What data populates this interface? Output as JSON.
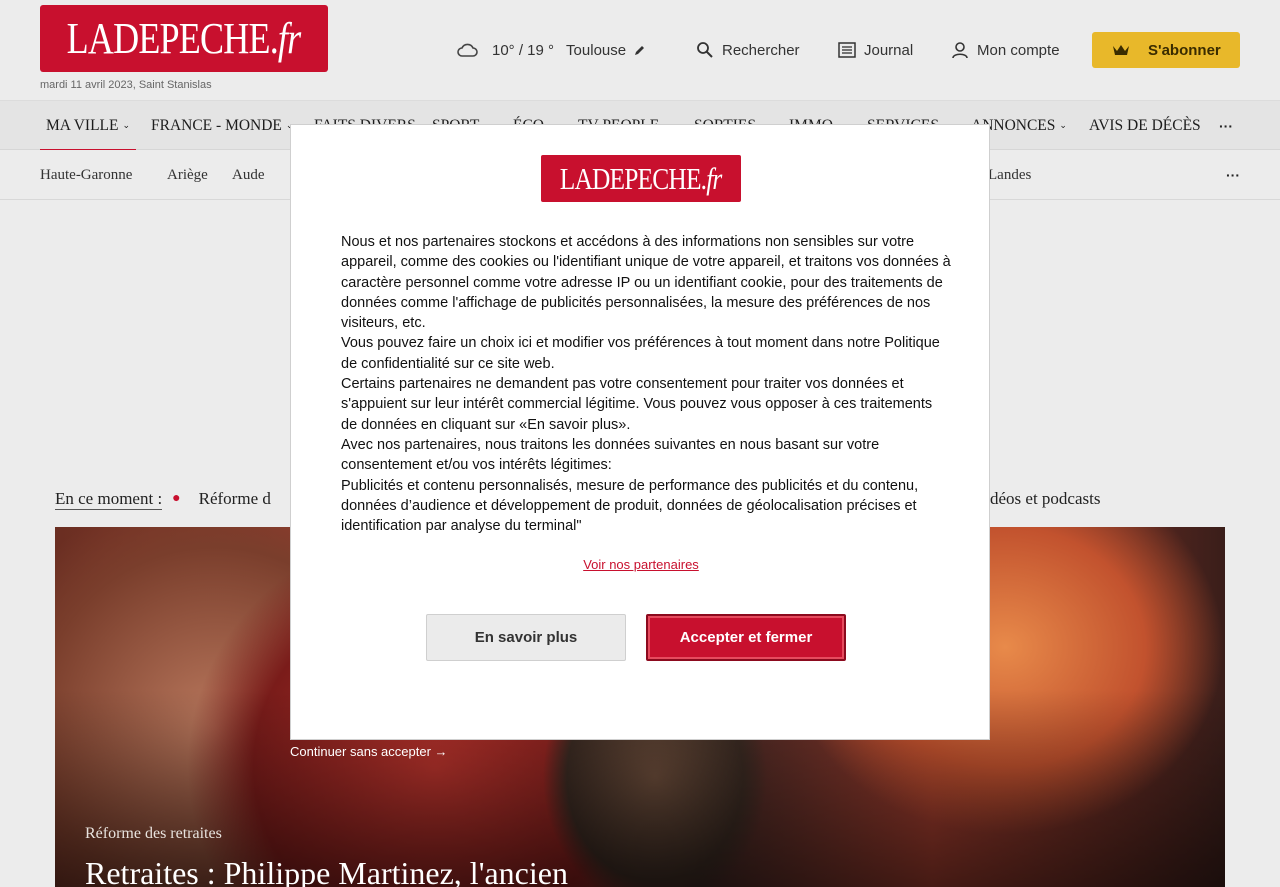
{
  "header": {
    "logo_main": "LADEPECHE",
    "logo_dot": ".",
    "logo_fr": "fr",
    "date": "mardi 11 avril 2023, Saint Stanislas",
    "weather_temp": "10° / 19 °",
    "weather_city": "Toulouse",
    "search_label": "Rechercher",
    "journal_label": "Journal",
    "account_label": "Mon compte",
    "subscribe_label": "S'abonner"
  },
  "nav": {
    "items": [
      {
        "label": "MA VILLE",
        "has_menu": true
      },
      {
        "label": "FRANCE - MONDE",
        "has_menu": true
      },
      {
        "label": "FAITS DIVERS",
        "has_menu": false
      },
      {
        "label": "SPORT",
        "has_menu": true
      },
      {
        "label": "ÉCO",
        "has_menu": true
      },
      {
        "label": "TV-PEOPLE",
        "has_menu": true
      },
      {
        "label": "SORTIES",
        "has_menu": true
      },
      {
        "label": "IMMO",
        "has_menu": true
      },
      {
        "label": "SERVICES",
        "has_menu": true
      },
      {
        "label": "ANNONCES",
        "has_menu": true
      },
      {
        "label": "AVIS DE DÉCÈS",
        "has_menu": false
      }
    ],
    "more": "···"
  },
  "subnav": {
    "items": [
      "Haute-Garonne",
      "Ariège",
      "Aude",
      "Landes"
    ],
    "more": "···"
  },
  "ticker": {
    "label": "En ce moment :",
    "first": "Réforme d",
    "right": "déos et podcasts"
  },
  "hero": {
    "kicker": "Réforme des retraites",
    "title": "Retraites : Philippe Martinez, l'ancien"
  },
  "consent": {
    "paragraphs": [
      "Nous et nos partenaires stockons et accédons à des informations non sensibles sur votre appareil, comme des cookies ou l'identifiant unique de votre appareil, et traitons vos données à caractère personnel comme votre adresse IP ou un identifiant cookie, pour des traitements de données comme l'affichage de publicités personnalisées, la mesure des préférences de nos visiteurs, etc.",
      "Vous pouvez faire un choix ici et modifier vos préférences à tout moment dans notre Politique de confidentialité sur ce site web.",
      "Certains partenaires ne demandent pas votre consentement pour traiter vos données et s'appuient sur leur intérêt commercial légitime. Vous pouvez vous opposer à ces traitements de données en cliquant sur «En savoir plus».",
      "Avec nos partenaires, nous traitons les données suivantes en nous basant sur votre consentement et/ou vos intérêts légitimes:",
      "Publicités et contenu personnalisés, mesure de performance des publicités et du contenu, données d’audience et développement de produit, données de géolocalisation précises et identification par analyse du terminal\""
    ],
    "partners_link": "Voir nos partenaires",
    "more_button": "En savoir plus",
    "accept_button": "Accepter et fermer",
    "continue_link": "Continuer sans accepter →"
  },
  "colors": {
    "brand_red": "#c8102e",
    "subscribe_gold": "#e8b82a"
  }
}
